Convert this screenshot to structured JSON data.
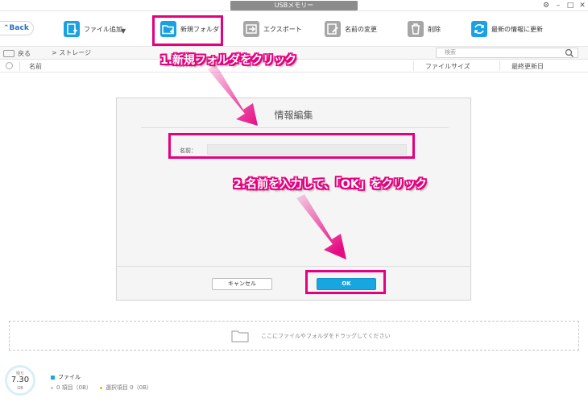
{
  "window": {
    "title": "USBメモリー",
    "controls": [
      "⚙",
      "–",
      "□",
      "✕"
    ]
  },
  "toolbar": {
    "back_label": "Back",
    "items": [
      {
        "label": "ファイル追加",
        "icon": "add-file-icon"
      },
      {
        "label": "新規フォルダ",
        "icon": "new-folder-icon"
      },
      {
        "label": "エクスポート",
        "icon": "export-icon"
      },
      {
        "label": "名前の変更",
        "icon": "rename-icon"
      },
      {
        "label": "削除",
        "icon": "trash-icon"
      },
      {
        "label": "最新の情報に更新",
        "icon": "refresh-icon"
      }
    ]
  },
  "nav": {
    "back_label": "戻る",
    "breadcrumb": "> ストレージ",
    "search_placeholder": "検索"
  },
  "columns": {
    "name": "名前",
    "size": "ファイルサイズ",
    "modified": "最終更新日"
  },
  "dialog": {
    "title": "情報編集",
    "name_label": "名前：",
    "name_value": "",
    "cancel_label": "キャンセル",
    "ok_label": "OK"
  },
  "annotations": {
    "step1": "1.新規フォルダをクリック",
    "step2": "2.名前を入力して、「OK」をクリック",
    "color": "#e5007e"
  },
  "dropzone": {
    "text": "ここにファイルやフォルダをドラッグしてください"
  },
  "status": {
    "ring_caption": "残り",
    "free_value": "7.30",
    "free_unit": "GB",
    "legend_label": "ファイル",
    "items_text": "0 項目（0B）",
    "selected_text": "選択項目 0（0B）"
  },
  "colors": {
    "accent": "#18a6e0",
    "highlight": "#e5007e"
  }
}
